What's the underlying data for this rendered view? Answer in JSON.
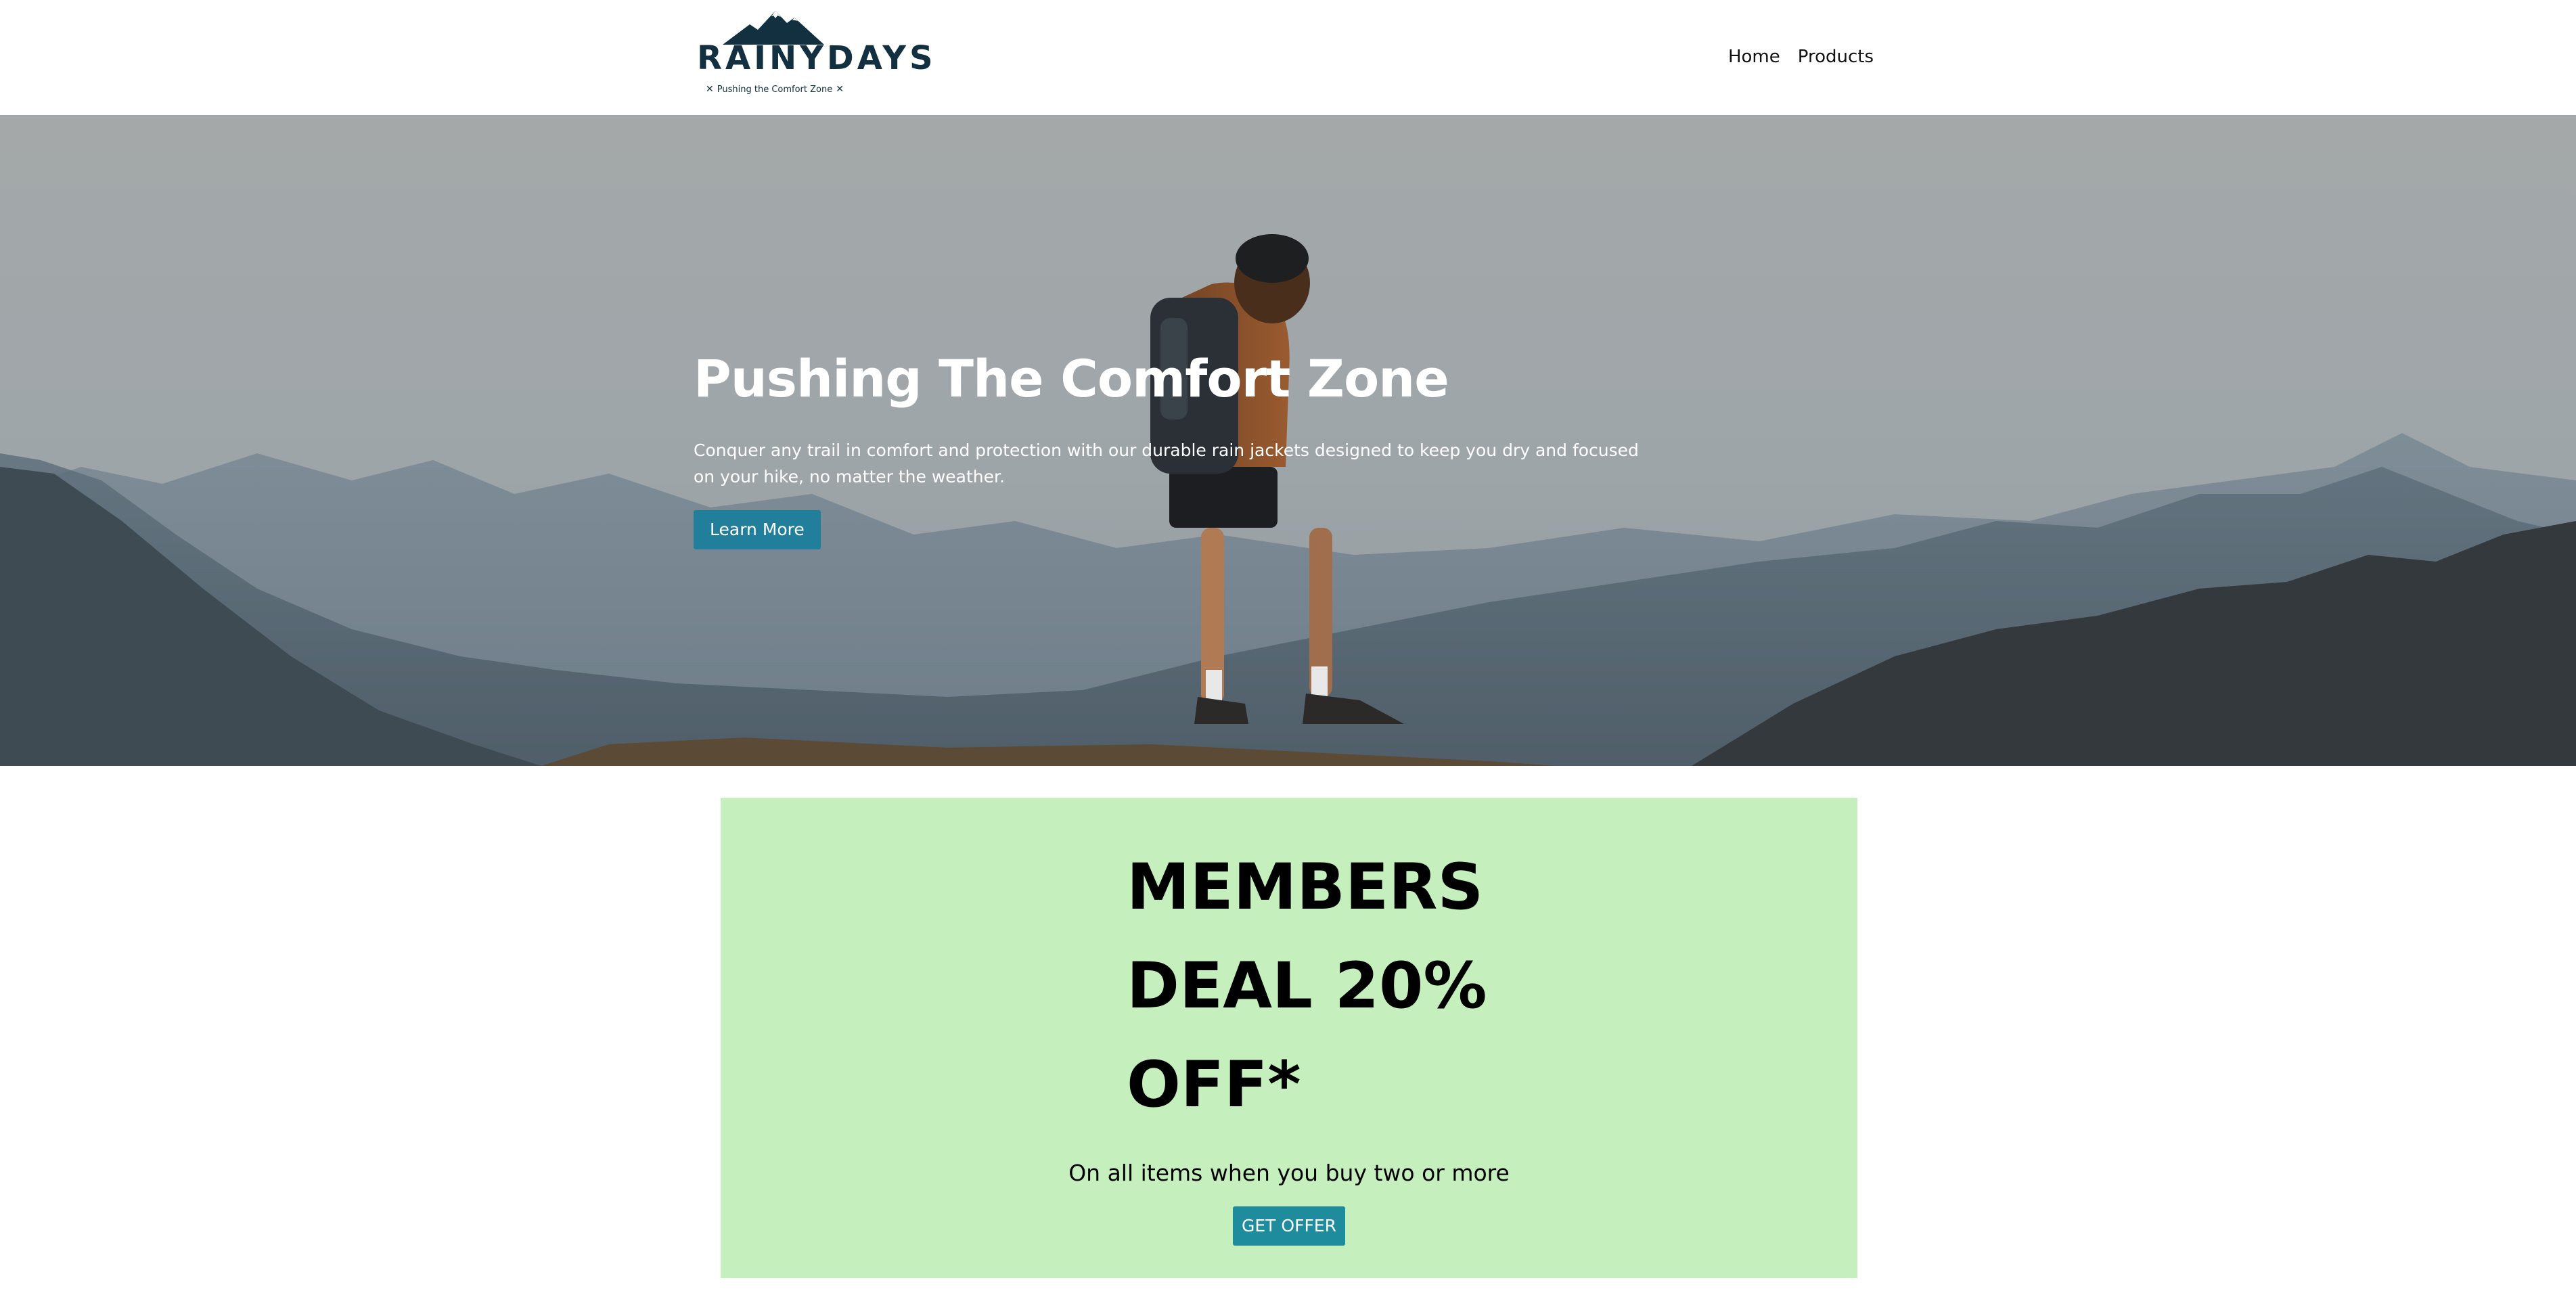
{
  "header": {
    "logo": {
      "wordmark": "RAINYDAYS",
      "tagline": "Pushing the Comfort Zone",
      "tagline_mark": "✕"
    },
    "nav": {
      "items": [
        {
          "label": "Home"
        },
        {
          "label": "Products"
        }
      ]
    }
  },
  "hero": {
    "title": "Pushing The Comfort Zone",
    "text": "Conquer any trail in comfort and protection with our durable rain jackets designed to keep you dry and focused on your hike, no matter the weather.",
    "button_label": "Learn More"
  },
  "promo": {
    "title": "MEMBERS DEAL 20% OFF*",
    "subtitle": "On all items when you buy two or more",
    "button_label": "GET OFFER"
  },
  "colors": {
    "brand_dark": "#12303f",
    "accent_button": "#217f9b",
    "promo_background": "#c5f0bd",
    "promo_button": "#1e8c9d"
  },
  "icons": {
    "logo_graphic": "mountain-icon"
  }
}
